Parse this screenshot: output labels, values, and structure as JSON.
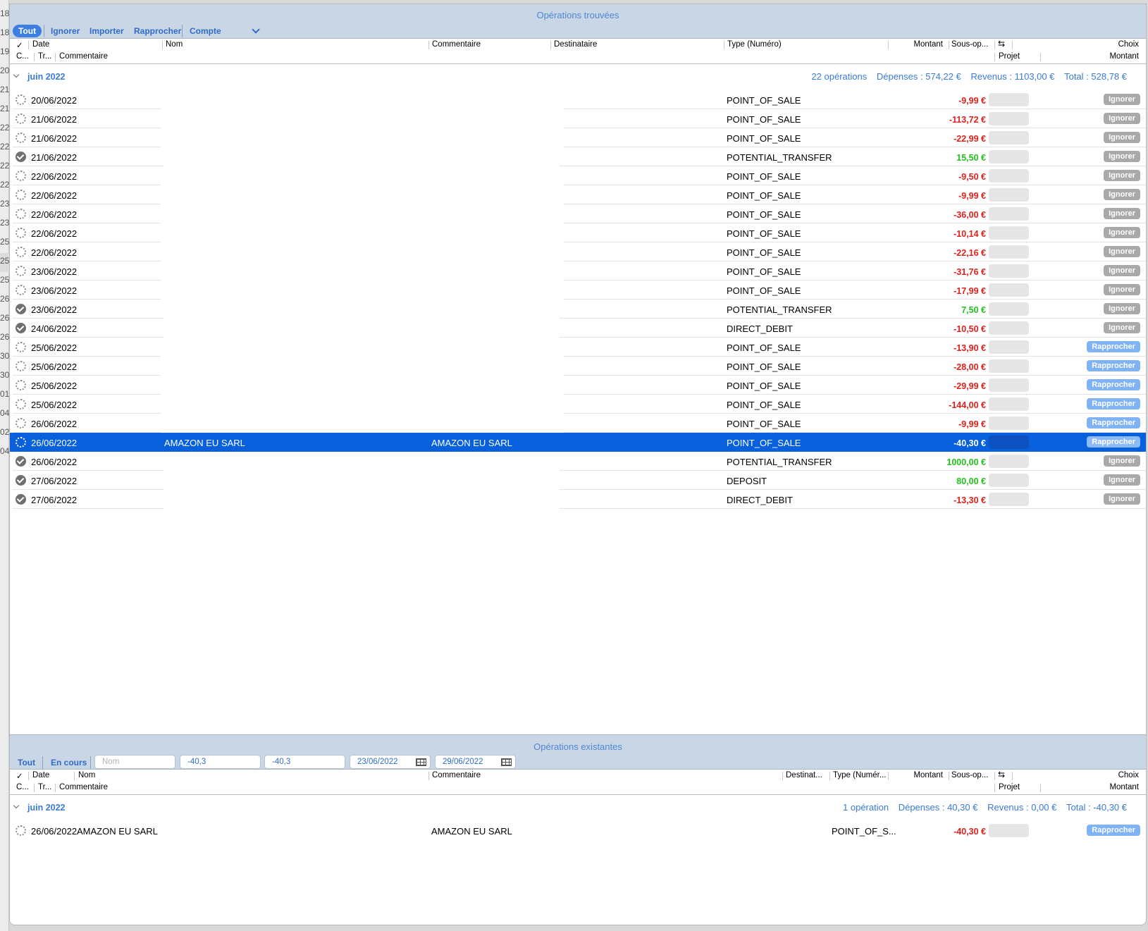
{
  "background_rows": [
    "18",
    "18",
    "19",
    "20",
    "21",
    "21",
    "22",
    "22",
    "22",
    "22",
    "23",
    "23",
    "25",
    "25",
    "25",
    "26",
    "26",
    "26",
    "30",
    "30",
    "01",
    "04",
    "02",
    "04"
  ],
  "top": {
    "title": "Opérations trouvées",
    "segments": [
      "Tout",
      "Ignorer",
      "Importer",
      "Rapprocher",
      "Compte"
    ],
    "headers": {
      "check": "✓",
      "date": "Date",
      "nom": "Nom",
      "commentaire": "Commentaire",
      "destinataire": "Destinataire",
      "type": "Type (Numéro)",
      "montant": "Montant",
      "sousop": "Sous-op...",
      "choix": "Choix",
      "c": "C...",
      "tr": "Tr...",
      "commentaire2": "Commentaire",
      "projet": "Projet",
      "montant2": "Montant"
    },
    "group": {
      "title": "juin 2022",
      "count": "22 opérations",
      "depenses": "Dépenses : 574,22 €",
      "revenus": "Revenus : 1103,00 €",
      "total": "Total : 528,78 €"
    },
    "rows": [
      {
        "status": "pending",
        "date": "20/06/2022",
        "nom": "",
        "dest": "",
        "type": "POINT_OF_SALE",
        "amount": "-9,99 €",
        "sign": "neg",
        "choice": "Ignorer"
      },
      {
        "status": "pending",
        "date": "21/06/2022",
        "nom": "",
        "dest": "",
        "type": "POINT_OF_SALE",
        "amount": "-113,72 €",
        "sign": "neg",
        "choice": "Ignorer"
      },
      {
        "status": "pending",
        "date": "21/06/2022",
        "nom": "",
        "dest": "",
        "type": "POINT_OF_SALE",
        "amount": "-22,99 €",
        "sign": "neg",
        "choice": "Ignorer"
      },
      {
        "status": "done",
        "date": "21/06/2022",
        "nom": "",
        "dest": "",
        "type": "POTENTIAL_TRANSFER",
        "amount": "15,50 €",
        "sign": "pos",
        "choice": "Ignorer"
      },
      {
        "status": "pending",
        "date": "22/06/2022",
        "nom": "",
        "dest": "",
        "type": "POINT_OF_SALE",
        "amount": "-9,50 €",
        "sign": "neg",
        "choice": "Ignorer"
      },
      {
        "status": "pending",
        "date": "22/06/2022",
        "nom": "",
        "dest": "",
        "type": "POINT_OF_SALE",
        "amount": "-9,99 €",
        "sign": "neg",
        "choice": "Ignorer"
      },
      {
        "status": "pending",
        "date": "22/06/2022",
        "nom": "",
        "dest": "",
        "type": "POINT_OF_SALE",
        "amount": "-36,00 €",
        "sign": "neg",
        "choice": "Ignorer"
      },
      {
        "status": "pending",
        "date": "22/06/2022",
        "nom": "",
        "dest": "",
        "type": "POINT_OF_SALE",
        "amount": "-10,14 €",
        "sign": "neg",
        "choice": "Ignorer"
      },
      {
        "status": "pending",
        "date": "22/06/2022",
        "nom": "",
        "dest": "",
        "type": "POINT_OF_SALE",
        "amount": "-22,16 €",
        "sign": "neg",
        "choice": "Ignorer"
      },
      {
        "status": "pending",
        "date": "23/06/2022",
        "nom": "",
        "dest": "",
        "type": "POINT_OF_SALE",
        "amount": "-31,76 €",
        "sign": "neg",
        "choice": "Ignorer"
      },
      {
        "status": "pending",
        "date": "23/06/2022",
        "nom": "",
        "dest": "",
        "type": "POINT_OF_SALE",
        "amount": "-17,99 €",
        "sign": "neg",
        "choice": "Ignorer"
      },
      {
        "status": "done",
        "date": "23/06/2022",
        "nom": "",
        "dest": "",
        "type": "POTENTIAL_TRANSFER",
        "amount": "7,50 €",
        "sign": "pos",
        "choice": "Ignorer"
      },
      {
        "status": "done",
        "date": "24/06/2022",
        "nom": "",
        "dest": "",
        "type": "DIRECT_DEBIT",
        "amount": "-10,50 €",
        "sign": "neg",
        "choice": "Ignorer"
      },
      {
        "status": "pending",
        "date": "25/06/2022",
        "nom": "",
        "dest": "",
        "type": "POINT_OF_SALE",
        "amount": "-13,90 €",
        "sign": "neg",
        "choice": "Rapprocher"
      },
      {
        "status": "pending",
        "date": "25/06/2022",
        "nom": "",
        "dest": "",
        "type": "POINT_OF_SALE",
        "amount": "-28,00 €",
        "sign": "neg",
        "choice": "Rapprocher"
      },
      {
        "status": "pending",
        "date": "25/06/2022",
        "nom": "",
        "dest": "",
        "type": "POINT_OF_SALE",
        "amount": "-29,99 €",
        "sign": "neg",
        "choice": "Rapprocher"
      },
      {
        "status": "pending",
        "date": "25/06/2022",
        "nom": "",
        "dest": "",
        "type": "POINT_OF_SALE",
        "amount": "-144,00 €",
        "sign": "neg",
        "choice": "Rapprocher"
      },
      {
        "status": "pending",
        "date": "26/06/2022",
        "nom": "",
        "dest": "",
        "type": "POINT_OF_SALE",
        "amount": "-9,99 €",
        "sign": "neg",
        "choice": "Rapprocher"
      },
      {
        "status": "pending",
        "date": "26/06/2022",
        "nom": "AMAZON EU SARL",
        "dest": "AMAZON EU SARL",
        "type": "POINT_OF_SALE",
        "amount": "-40,30 €",
        "sign": "neg",
        "choice": "Rapprocher",
        "selected": true
      },
      {
        "status": "done",
        "date": "26/06/2022",
        "nom": "",
        "dest": "",
        "type": "POTENTIAL_TRANSFER",
        "amount": "1000,00 €",
        "sign": "pos",
        "choice": "Ignorer"
      },
      {
        "status": "done",
        "date": "27/06/2022",
        "nom": "",
        "dest": "",
        "type": "DEPOSIT",
        "amount": "80,00 €",
        "sign": "pos",
        "choice": "Ignorer"
      },
      {
        "status": "done",
        "date": "27/06/2022",
        "nom": "",
        "dest": "",
        "type": "DIRECT_DEBIT",
        "amount": "-13,30 €",
        "sign": "neg",
        "choice": "Ignorer"
      }
    ]
  },
  "bottom": {
    "title": "Opérations existantes",
    "segments": [
      "Tout",
      "En cours"
    ],
    "filters": {
      "nom_placeholder": "Nom",
      "montant_min": "-40,3",
      "montant_max": "-40,3",
      "date_from": "23/06/2022",
      "date_to": "29/06/2022"
    },
    "headers": {
      "check": "✓",
      "date": "Date",
      "nom": "Nom",
      "commentaire": "Commentaire",
      "destinataire": "Destinat...",
      "type": "Type (Numér...",
      "montant": "Montant",
      "sousop": "Sous-op...",
      "choix": "Choix",
      "c": "C...",
      "tr": "Tr...",
      "commentaire2": "Commentaire",
      "projet": "Projet",
      "montant2": "Montant"
    },
    "group": {
      "title": "juin 2022",
      "count": "1 opération",
      "depenses": "Dépenses : 40,30 €",
      "revenus": "Revenus : 0,00 €",
      "total": "Total : -40,30 €"
    },
    "row": {
      "status": "pending",
      "date": "26/06/2022",
      "nom": "AMAZON EU SARL",
      "dest": "AMAZON EU SARL",
      "type": "POINT_OF_S...",
      "amount": "-40,30 €",
      "choice": "Rapprocher"
    }
  },
  "colors": {
    "accent": "#3c7fe0",
    "selection": "#0860dc",
    "negative": "#e0201b",
    "positive": "#22c21c",
    "panel": "#c9d6e6"
  }
}
